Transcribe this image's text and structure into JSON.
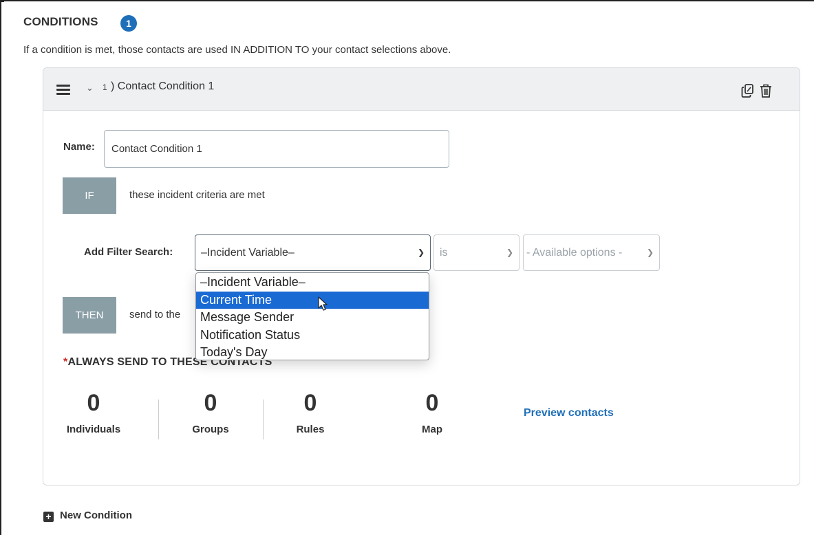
{
  "header": {
    "title": "CONDITIONS",
    "count": "1",
    "description": "If a condition is met, those contacts are used IN ADDITION TO your contact selections above."
  },
  "condition": {
    "number": "1",
    "title": ") Contact Condition 1",
    "name_label": "Name:",
    "name_value": "Contact Condition 1",
    "if_label": "IF",
    "if_text": "these incident criteria are met",
    "filter_label": "Add Filter Search:",
    "filter_variable": "–Incident Variable–",
    "filter_operator": "is",
    "filter_value": "- Available options -",
    "then_label": "THEN",
    "then_text": "send to the",
    "always_required": "*",
    "always_title": "ALWAYS SEND TO THESE CONTACTS",
    "stats": [
      {
        "value": "0",
        "label": "Individuals"
      },
      {
        "value": "0",
        "label": "Groups"
      },
      {
        "value": "0",
        "label": "Rules"
      },
      {
        "value": "0",
        "label": "Map"
      }
    ],
    "preview_label": "Preview contacts"
  },
  "dropdown": {
    "options": [
      "–Incident Variable–",
      "Current Time",
      "Message Sender",
      "Notification Status",
      "Today's Day"
    ],
    "highlighted": "Current Time"
  },
  "footer": {
    "new_condition_label": "New Condition"
  },
  "colors": {
    "accent": "#1f6fb8",
    "label_box": "#8a9ea6",
    "highlight": "#1a6ad3",
    "required": "#cc2a2a"
  },
  "icons": [
    "hamburger-icon",
    "chevron-down-icon",
    "copy-icon",
    "trash-icon",
    "plus-icon",
    "cursor-icon"
  ]
}
